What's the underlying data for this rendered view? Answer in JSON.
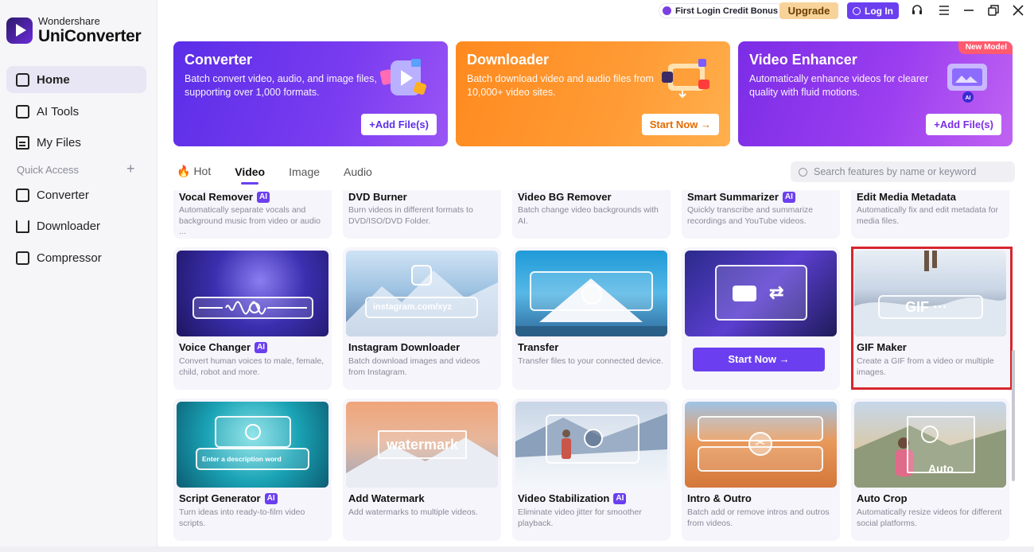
{
  "app": {
    "brand": "Wondershare",
    "name": "UniConverter"
  },
  "sidebar": {
    "items": [
      {
        "label": "Home",
        "icon": "home-icon"
      },
      {
        "label": "AI Tools",
        "icon": "ai-tools-icon"
      },
      {
        "label": "My Files",
        "icon": "file-icon"
      }
    ],
    "quick_access_label": "Quick Access",
    "quick_items": [
      {
        "label": "Converter",
        "icon": "converter-icon"
      },
      {
        "label": "Downloader",
        "icon": "downloader-icon"
      },
      {
        "label": "Compressor",
        "icon": "compressor-icon"
      }
    ]
  },
  "topbar": {
    "bonus": "First Login Credit Bonus",
    "upgrade": "Upgrade",
    "login": "Log In"
  },
  "banners": [
    {
      "title": "Converter",
      "desc": "Batch convert video, audio, and image files, supporting over 1,000 formats.",
      "button": "+Add File(s)"
    },
    {
      "title": "Downloader",
      "desc": "Batch download video and audio files from 10,000+ video sites.",
      "button": "Start Now →"
    },
    {
      "title": "Video Enhancer",
      "desc": "Automatically enhance videos for clearer quality with fluid motions.",
      "button": "+Add File(s)",
      "badge": "New Model"
    }
  ],
  "tabs": [
    "Hot",
    "Video",
    "Image",
    "Audio"
  ],
  "search": {
    "placeholder": "Search features by name or keyword"
  },
  "row0": [
    {
      "title": "Vocal Remover",
      "ai": true,
      "desc": "Automatically separate vocals and background music from video or audio ..."
    },
    {
      "title": "DVD Burner",
      "ai": false,
      "desc": "Burn videos in different formats to DVD/ISO/DVD Folder."
    },
    {
      "title": "Video BG Remover",
      "ai": false,
      "desc": "Batch change video backgrounds with AI."
    },
    {
      "title": "Smart Summarizer",
      "ai": true,
      "desc": "Quickly transcribe and summarize recordings and YouTube videos."
    },
    {
      "title": "Edit Media Metadata",
      "ai": false,
      "desc": "Automatically fix and edit metadata for media files."
    }
  ],
  "row1": [
    {
      "title": "Voice Changer",
      "ai": true,
      "desc": "Convert human voices to male, female, child, robot and more."
    },
    {
      "title": "Instagram Downloader",
      "ai": false,
      "desc": "Batch download images and videos from Instagram.",
      "overlay": "instagram.com/xyz"
    },
    {
      "title": "Transfer",
      "ai": false,
      "desc": "Transfer files to your connected device."
    },
    {
      "start_now": "Start Now"
    },
    {
      "title": "GIF Maker",
      "ai": false,
      "desc": "Create a GIF from a video or multiple images.",
      "overlay": "GIF"
    }
  ],
  "row2": [
    {
      "title": "Script Generator",
      "ai": true,
      "desc": "Turn ideas into ready-to-film video scripts.",
      "overlay": "Enter a description word"
    },
    {
      "title": "Add Watermark",
      "ai": false,
      "desc": "Add watermarks to multiple videos.",
      "overlay": "watermark"
    },
    {
      "title": "Video Stabilization",
      "ai": true,
      "desc": "Eliminate video jitter for smoother playback."
    },
    {
      "title": "Intro & Outro",
      "ai": false,
      "desc": "Batch add or remove intros and outros from videos."
    },
    {
      "title": "Auto Crop",
      "ai": false,
      "desc": "Automatically resize videos for different social platforms.",
      "overlay": "Auto"
    }
  ],
  "ai_label": "AI",
  "colors": {
    "accent": "#6b3ff0",
    "highlight": "#d6262e"
  }
}
